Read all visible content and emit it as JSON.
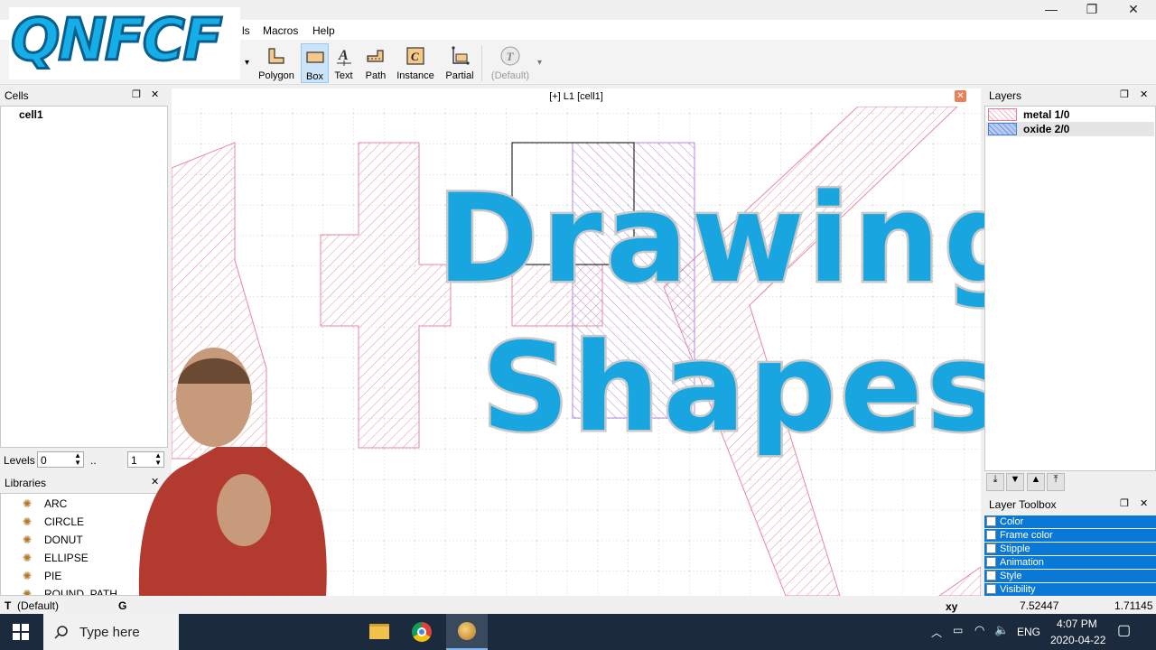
{
  "window": {
    "minimize": "—",
    "restore": "❐",
    "close": "✕"
  },
  "menu": {
    "items": [
      "ls",
      "Macros",
      "Help"
    ]
  },
  "toolbar": {
    "tools": [
      {
        "label": "Polygon",
        "icon": "polygon-icon"
      },
      {
        "label": "Box",
        "icon": "box-icon",
        "active": true
      },
      {
        "label": "Text",
        "icon": "text-icon"
      },
      {
        "label": "Path",
        "icon": "path-icon"
      },
      {
        "label": "Instance",
        "icon": "instance-icon"
      },
      {
        "label": "Partial",
        "icon": "partial-icon"
      },
      {
        "label": "(Default)",
        "icon": "text-style-icon",
        "disabled": true
      }
    ]
  },
  "cells": {
    "title": "Cells",
    "items": [
      "cell1"
    ],
    "levels_label": "Levels",
    "level_from": "0",
    "level_sep": "..",
    "level_to": "1"
  },
  "libraries": {
    "title": "Libraries",
    "items": [
      "ARC",
      "CIRCLE",
      "DONUT",
      "ELLIPSE",
      "PIE",
      "ROUND_PATH"
    ]
  },
  "canvas": {
    "title": "[+] L1 [cell1]"
  },
  "layers": {
    "title": "Layers",
    "items": [
      {
        "name": "metal 1/0",
        "color": "#e87a92"
      },
      {
        "name": "oxide 2/0",
        "color": "#4a7fd4"
      }
    ]
  },
  "layer_toolbox": {
    "title": "Layer Toolbox",
    "items": [
      "Color",
      "Frame color",
      "Stipple",
      "Animation",
      "Style",
      "Visibility"
    ]
  },
  "status": {
    "text_style": "(Default)",
    "text_style_prefix": "T",
    "grid_prefix": "G",
    "coord_label": "xy",
    "x": "7.52447",
    "y": "1.71145"
  },
  "overlay": {
    "logo": "QNFCF",
    "line1": "Drawing",
    "line2": "Shapes"
  },
  "taskbar": {
    "search_placeholder": "Type here",
    "lang": "ENG",
    "time": "4:07 PM",
    "date": "2020-04-22"
  },
  "colors": {
    "accent": "#19a6e0",
    "metal": "#e87a92",
    "oxide": "#8f63d6",
    "selection": "#0a78d7"
  }
}
